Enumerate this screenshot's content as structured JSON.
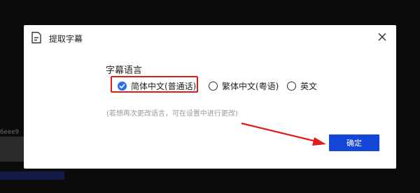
{
  "background": {
    "fragment_text": "6eee9"
  },
  "dialog": {
    "title": "提取字幕",
    "section_label": "字幕语言",
    "options": [
      {
        "label": "简体中文(普通话)",
        "checked": true
      },
      {
        "label": "繁体中文(粤语)",
        "checked": false
      },
      {
        "label": "英文",
        "checked": false
      }
    ],
    "hint": "(若想再次更改语言，可在设置中进行更改)",
    "confirm_label": "确定"
  },
  "colors": {
    "accent": "#1446d8",
    "radio_checked": "#2a6ef0",
    "annotation_red": "#e01b1b"
  }
}
